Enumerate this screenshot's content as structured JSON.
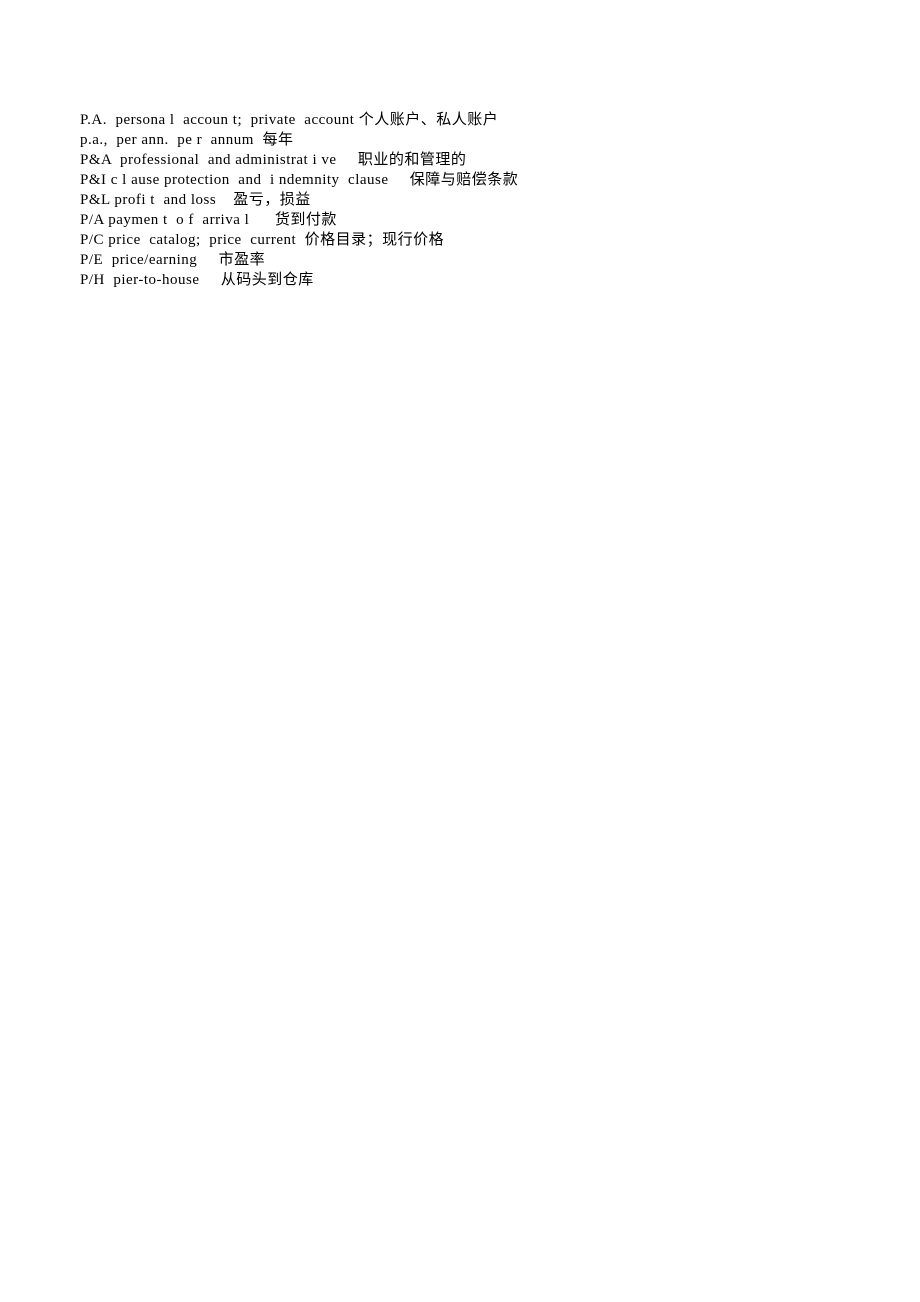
{
  "entries": [
    {
      "abbr": "P.A.",
      "expansion": "persona l  accoun t;  private  account",
      "meaning": "个人账户、私人账户"
    },
    {
      "abbr": "p.a.,",
      "expansion": "per ann.  pe r  annum ",
      "meaning": "每年"
    },
    {
      "abbr": "P&A",
      "expansion": "professional  and administrat i ve    ",
      "meaning": "职业的和管理的"
    },
    {
      "abbr": "P&I",
      "expansion": "c l ause protection  and  i ndemnity  clause    ",
      "meaning": "保障与赔偿条款"
    },
    {
      "abbr": "P&L",
      "expansion": "profi t  and loss   ",
      "meaning": "盈亏，损益"
    },
    {
      "abbr": "P/A",
      "expansion": "paymen t  o f  arriva l     ",
      "meaning": "货到付款"
    },
    {
      "abbr": "P/C",
      "expansion": "price  catalog;  price  current ",
      "meaning": "价格目录；现行价格"
    },
    {
      "abbr": "P/E ",
      "expansion": "price/earning    ",
      "meaning": "市盈率"
    },
    {
      "abbr": "P/H ",
      "expansion": "pier-to-house    ",
      "meaning": "从码头到仓库"
    }
  ]
}
